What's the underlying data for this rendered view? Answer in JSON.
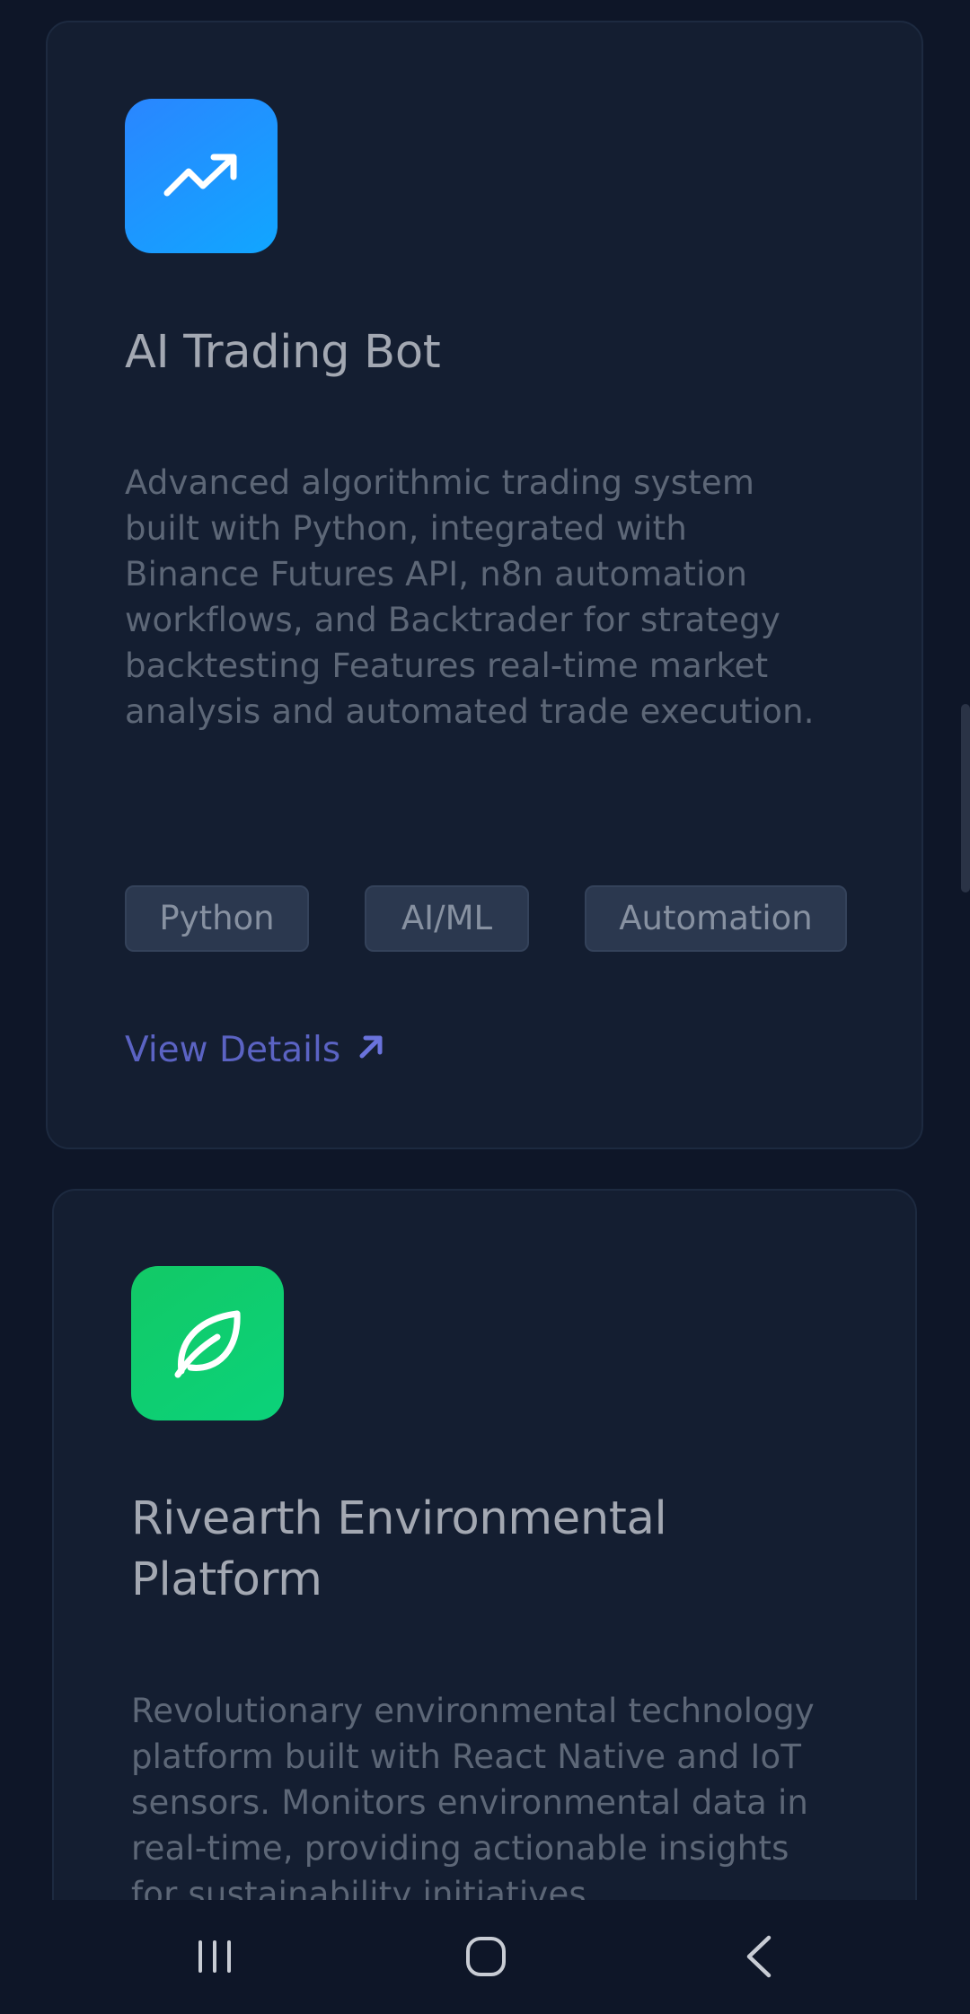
{
  "projects": [
    {
      "icon": "trending-up-icon",
      "icon_color": "#1a9bff",
      "title": "AI Trading Bot",
      "description_lines": [
        "Advanced algorithmic trading system",
        "built with Python, integrated with",
        "Binance Futures API, n8n automation",
        "workflows, and Backtrader for strategy",
        "backtesting Features real-time market",
        "analysis and automated trade execution."
      ],
      "tags": [
        "Python",
        "AI/ML",
        "Automation"
      ],
      "link_label": "View Details"
    },
    {
      "icon": "leaf-icon",
      "icon_color": "#0fcd70",
      "title_lines": [
        "Rivearth Environmental",
        "Platform"
      ],
      "description_lines": [
        "Revolutionary environmental technology",
        "platform built with React Native and IoT",
        "sensors. Monitors environmental data in",
        "real-time, providing actionable insights",
        "for sustainability initiatives."
      ]
    }
  ],
  "nav": {
    "recents": "recent-apps-icon",
    "home": "home-icon",
    "back": "back-icon"
  },
  "colors": {
    "background": "#0e1628",
    "card": "#141e31",
    "link": "#5b63c3",
    "tag_bg": "#2b384f"
  }
}
